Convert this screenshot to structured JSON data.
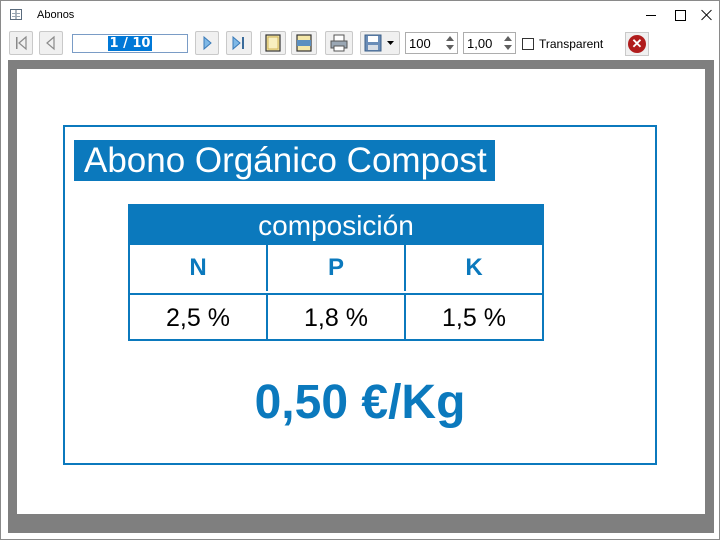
{
  "window": {
    "title": "Abonos"
  },
  "toolbar": {
    "page_indicator": "1 / 10",
    "zoom_value": "100",
    "scale_value": "1,00",
    "transparent_label": "Transparent"
  },
  "page": {
    "product_title": "Abono Orgánico Compost",
    "composition": {
      "heading": "composición",
      "columns": [
        "N",
        "P",
        "K"
      ],
      "values": [
        "2,5 %",
        "1,8 %",
        "1,5 %"
      ]
    },
    "price": "0,50 €/Kg"
  },
  "colors": {
    "accent": "#0b79bd",
    "viewer_bg": "#7f7f7f"
  }
}
